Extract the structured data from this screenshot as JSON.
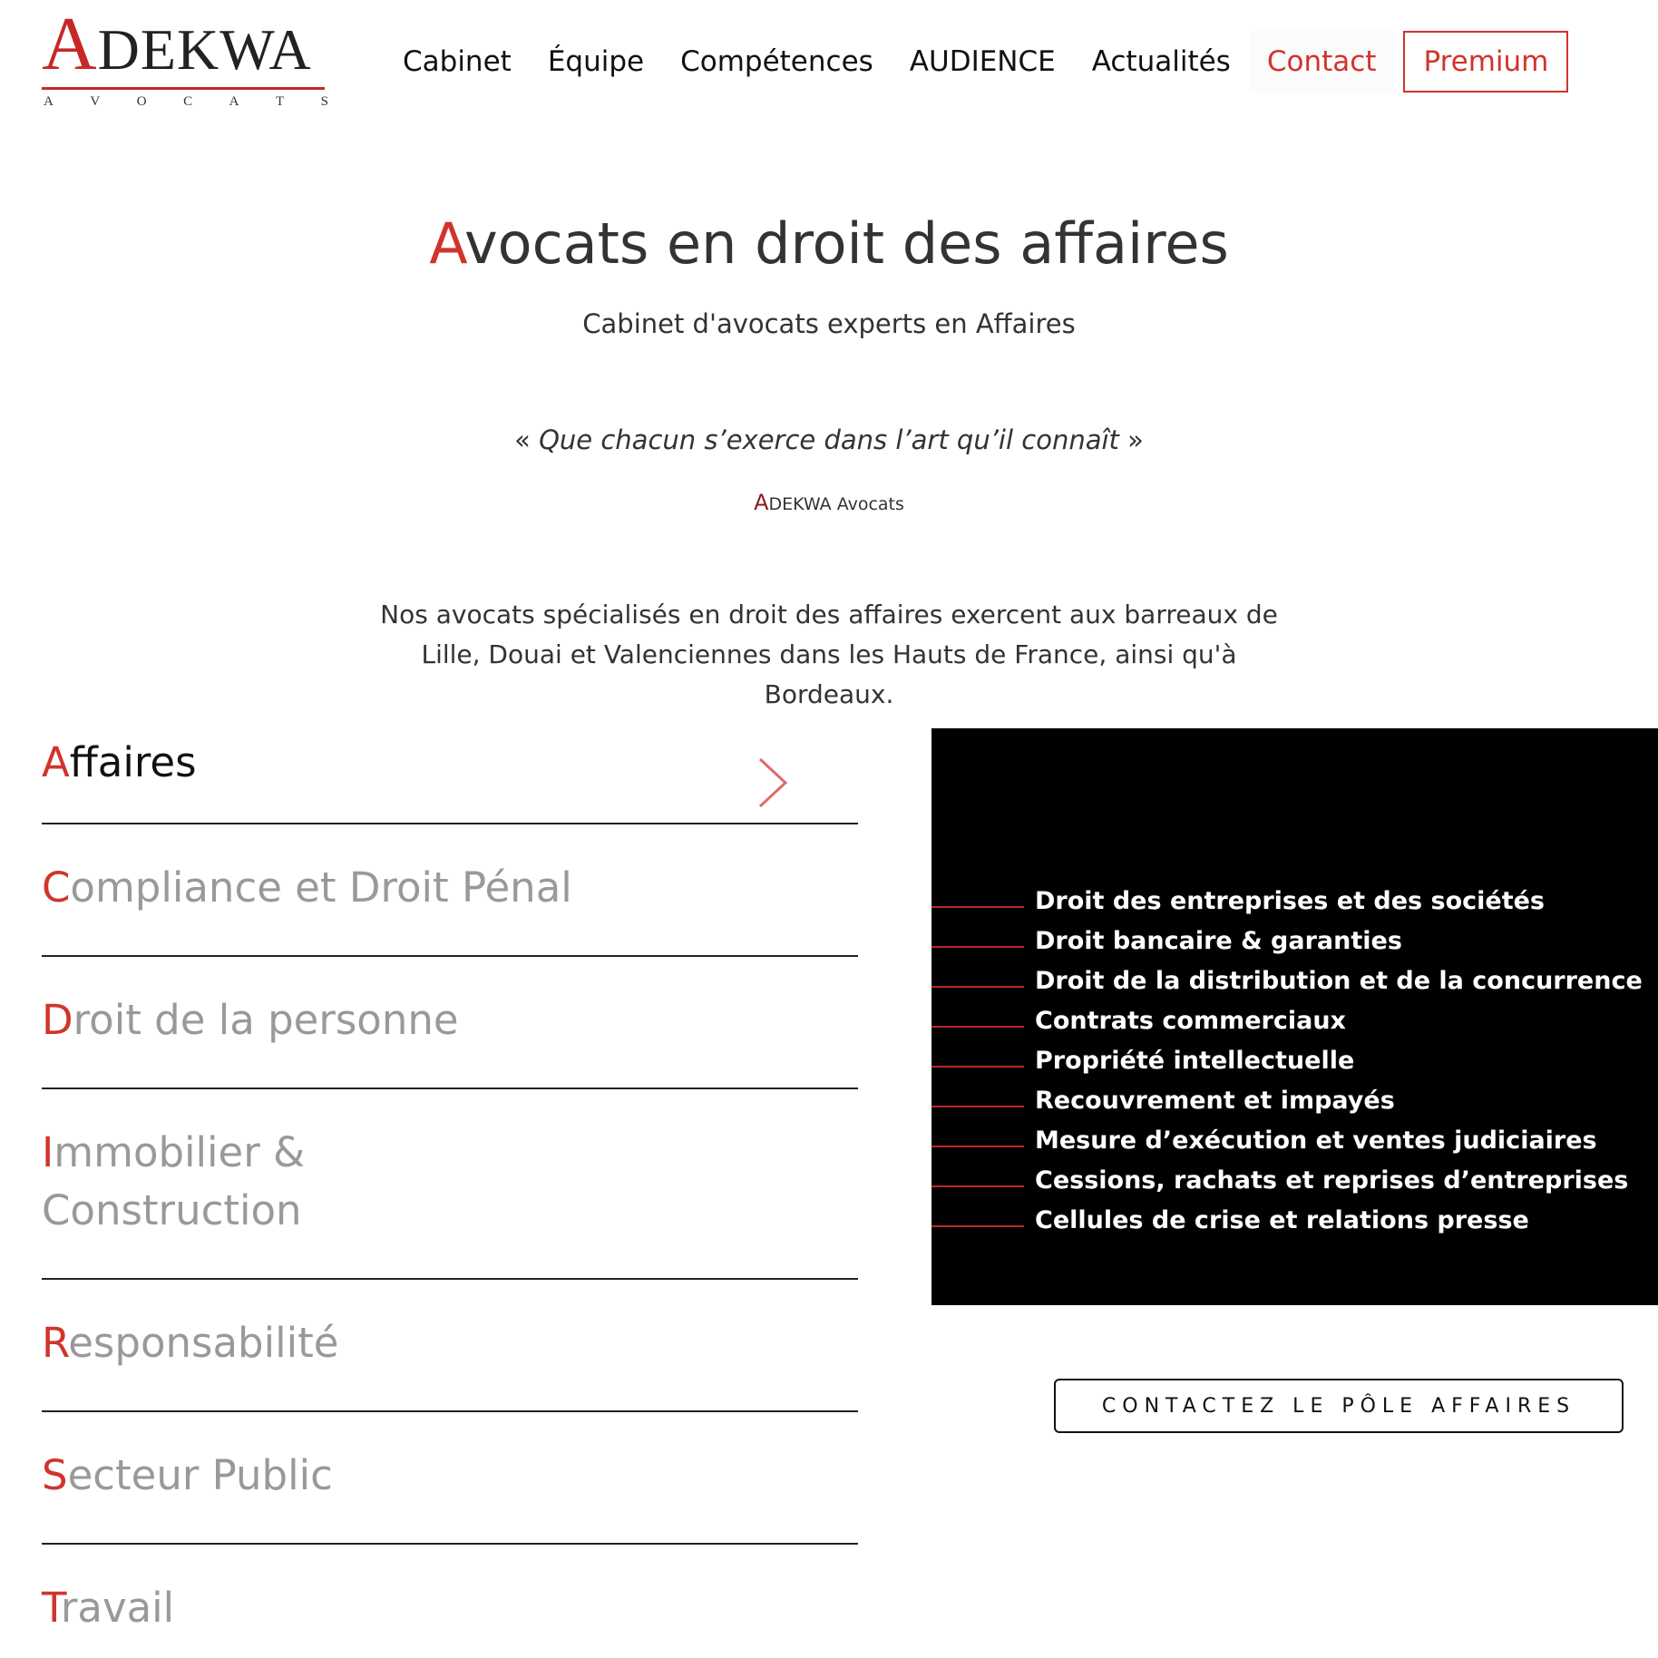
{
  "header": {
    "logo": {
      "initial": "A",
      "rest": "DEKWA",
      "subtitle": [
        "A",
        "V",
        "O",
        "C",
        "A",
        "T",
        "S"
      ]
    },
    "nav": [
      {
        "label": "Cabinet"
      },
      {
        "label": "Équipe"
      },
      {
        "label": "Compétences"
      },
      {
        "label": "AUDIENCE"
      },
      {
        "label": "Actualités"
      },
      {
        "label": "Contact"
      }
    ],
    "premium_label": "Premium"
  },
  "hero": {
    "title_initial": "A",
    "title_rest": "vocats en droit des affaires",
    "subtitle": "Cabinet d'avocats experts en Affaires",
    "quote_open": "« ",
    "quote_text": "Que chacun s’exerce dans l’art qu’il connaît",
    "quote_close": " »",
    "author_initial": "A",
    "author_rest": "DEKWA Avocats",
    "intro": "Nos avocats spécialisés en droit des affaires exercent aux barreaux de Lille, Douai et Valenciennes dans les Hauts de France, ainsi qu'à Bordeaux."
  },
  "practice_areas": [
    {
      "initial": "A",
      "rest": "ffaires",
      "active": true
    },
    {
      "initial": "C",
      "rest": "ompliance et Droit Pénal"
    },
    {
      "initial": "D",
      "rest": "roit de la personne"
    },
    {
      "initial": "I",
      "rest": "mmobilier &",
      "rest_line2": "Construction"
    },
    {
      "initial": "R",
      "rest": "esponsabilité"
    },
    {
      "initial": "S",
      "rest": "ecteur Public"
    },
    {
      "initial": "T",
      "rest": "ravail"
    }
  ],
  "panel": {
    "items": [
      "Droit des entreprises et des sociétés",
      "Droit bancaire & garanties",
      "Droit de la distribution et de la concurrence",
      "Contrats commerciaux",
      "Propriété intellectuelle",
      "Recouvrement et impayés",
      "Mesure d’exécution et ventes judiciaires",
      "Cessions, rachats et reprises d’entreprises",
      "Cellules de crise et relations presse"
    ]
  },
  "cta_label": "CONTACTEZ LE PÔLE AFFAIRES",
  "colors": {
    "accent": "#d0342c",
    "panel_bg": "#000000",
    "text": "#333333",
    "muted": "#999999"
  }
}
